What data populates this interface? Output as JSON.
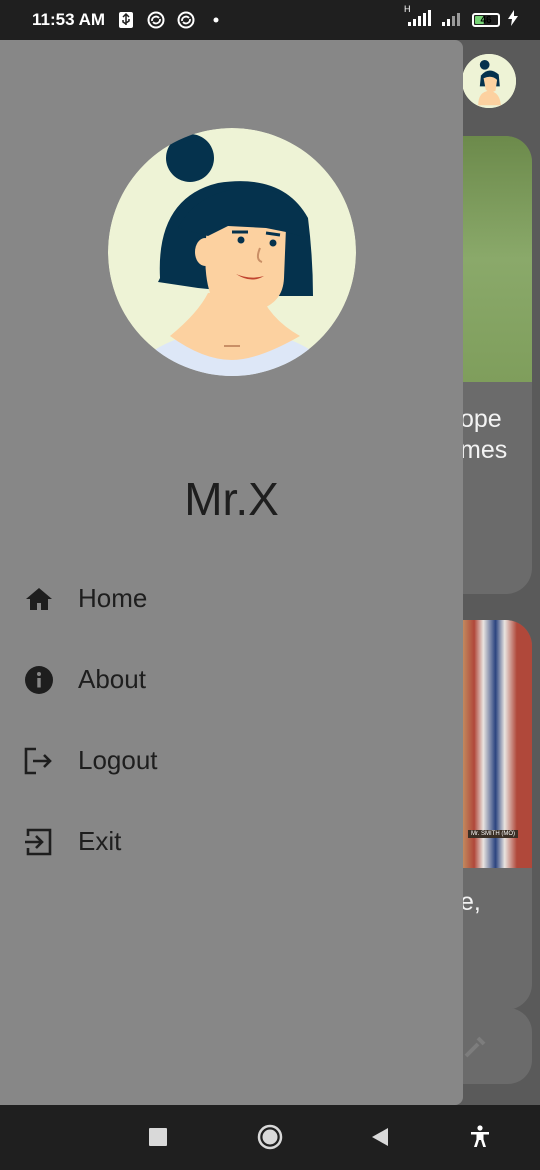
{
  "status_bar": {
    "time": "11:53 AM",
    "icons": [
      "usb-icon",
      "sync-icon",
      "sync-icon",
      "dot-icon"
    ],
    "network": "H",
    "battery": "46",
    "battery_level": 0.46
  },
  "background_app": {
    "card1_text_line1": "ope",
    "card1_text_line2": "mes",
    "card2_text": "e,",
    "card2_caption": "Mr. SMITH (MO)"
  },
  "drawer": {
    "username": "Mr.X",
    "menu": [
      {
        "label": "Home",
        "icon": "home-icon"
      },
      {
        "label": "About",
        "icon": "info-icon"
      },
      {
        "label": "Logout",
        "icon": "logout-icon"
      },
      {
        "label": "Exit",
        "icon": "exit-icon"
      }
    ]
  },
  "nav_bar": {
    "buttons": [
      "recents-button",
      "home-button",
      "back-button",
      "accessibility-button"
    ]
  },
  "colors": {
    "drawer_bg": "#878787",
    "scrim_bg": "#5a5a5a",
    "text": "#1e1e1e",
    "hair": "#05324d",
    "skin": "#fcd1a0",
    "avatar_bg": "#eef3d6"
  }
}
